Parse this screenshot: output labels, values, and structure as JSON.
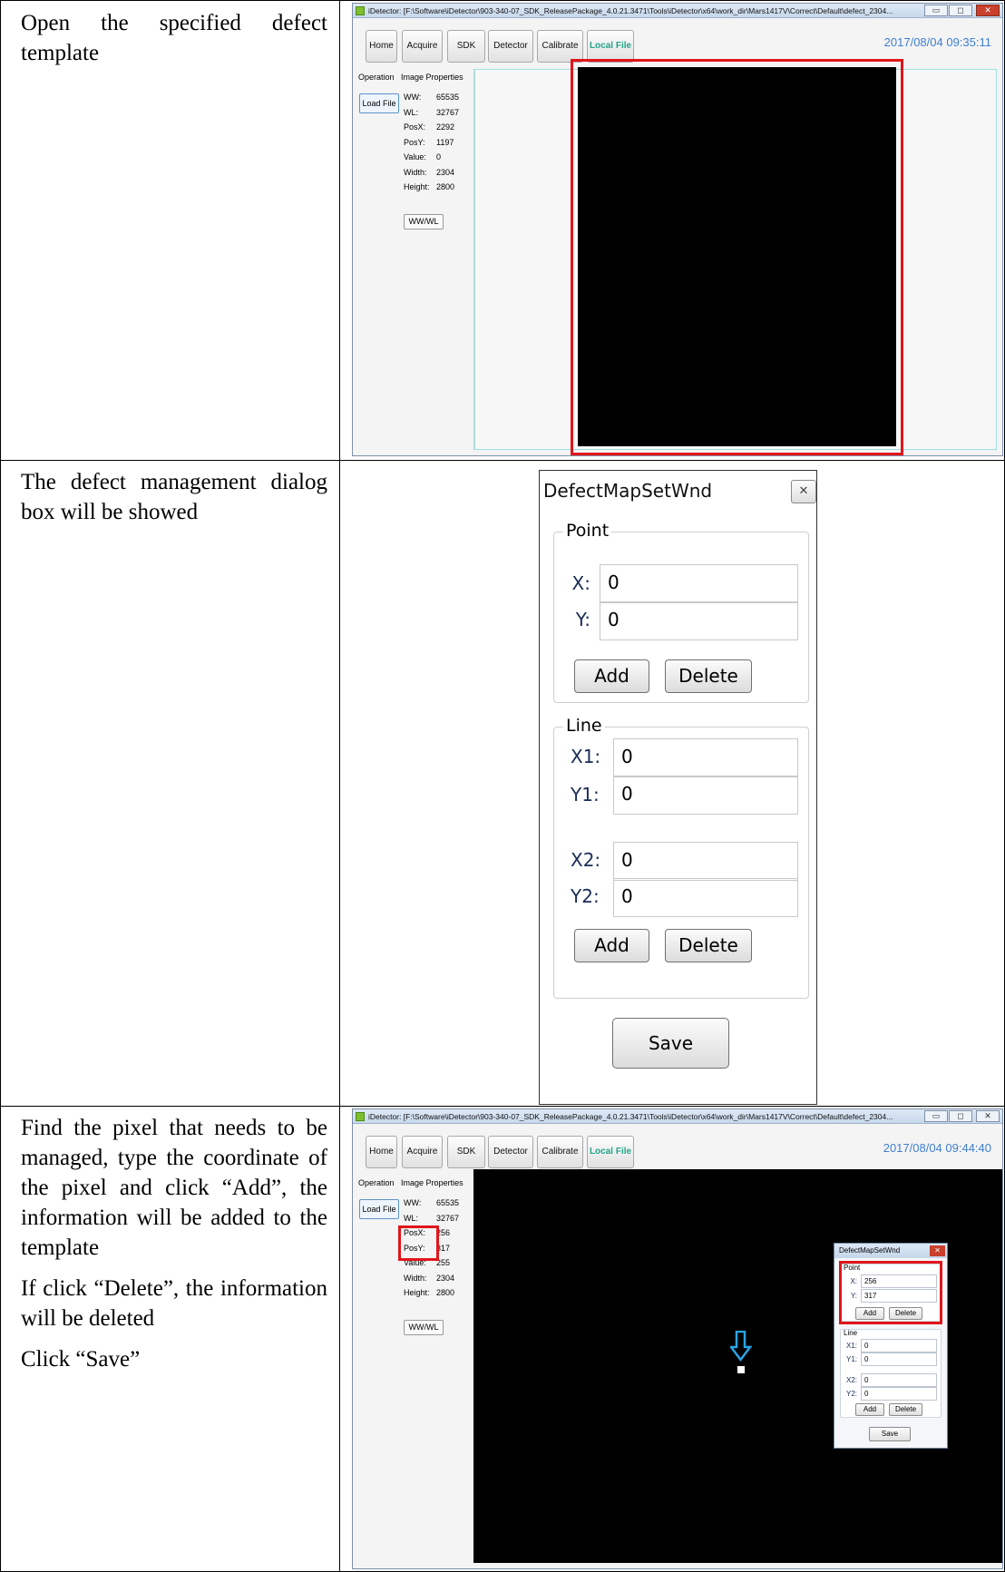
{
  "steps": [
    {
      "text": "Open the specified defect template"
    },
    {
      "text": "The defect management dialog box will be showed"
    },
    {
      "paragraphs": [
        "Find the pixel that needs to be managed, type the coordinate of the pixel and click “Add”, the information will be added to the template",
        "If click “Delete”, the information will be deleted",
        "Click “Save”"
      ]
    }
  ],
  "app": {
    "title": "iDetector: [F:\\Software\\iDetector\\903-340-07_SDK_ReleasePackage_4.0.21.3471\\Tools\\iDetector\\x64\\work_dir\\Mars1417V\\Correct\\Default\\defect_2304...",
    "nav": [
      "Home",
      "Acquire",
      "SDK",
      "Detector",
      "Calibrate",
      "Local File"
    ],
    "side_tabs": [
      "Operation",
      "Image Properties"
    ],
    "load_file": "Load File",
    "wwwl_button": "WW/WL",
    "window_controls": [
      "▭",
      "◻",
      "✕"
    ]
  },
  "screen1": {
    "timestamp": "2017/08/04 09:35:11",
    "props": [
      {
        "k": "WW:",
        "v": "65535"
      },
      {
        "k": "WL:",
        "v": "32767"
      },
      {
        "k": "PosX:",
        "v": "2292"
      },
      {
        "k": "PosY:",
        "v": "1197"
      },
      {
        "k": "Value:",
        "v": "0"
      },
      {
        "k": "Width:",
        "v": "2304"
      },
      {
        "k": "Height:",
        "v": "2800"
      }
    ]
  },
  "dialog": {
    "title": "DefectMapSetWnd",
    "close": "✕",
    "point_group": "Point",
    "x_label": "X:",
    "x_value": "0",
    "y_label": "Y:",
    "y_value": "0",
    "line_group": "Line",
    "x1_label": "X1:",
    "x1_value": "0",
    "y1_label": "Y1:",
    "y1_value": "0",
    "x2_label": "X2:",
    "x2_value": "0",
    "y2_label": "Y2:",
    "y2_value": "0",
    "add": "Add",
    "delete": "Delete",
    "save": "Save"
  },
  "screen3": {
    "timestamp": "2017/08/04 09:44:40",
    "props": [
      {
        "k": "WW:",
        "v": "65535"
      },
      {
        "k": "WL:",
        "v": "32767"
      },
      {
        "k": "PosX:",
        "v": "256"
      },
      {
        "k": "PosY:",
        "v": "317"
      },
      {
        "k": "Value:",
        "v": "255"
      },
      {
        "k": "Width:",
        "v": "2304"
      },
      {
        "k": "Height:",
        "v": "2800"
      }
    ],
    "dialog_x_value": "256",
    "dialog_y_value": "317"
  },
  "colors": {
    "highlight": "#e0161b",
    "accent": "#3e7fd1",
    "active_tab": "#22a58a",
    "arrow": "#2aa3e6"
  }
}
